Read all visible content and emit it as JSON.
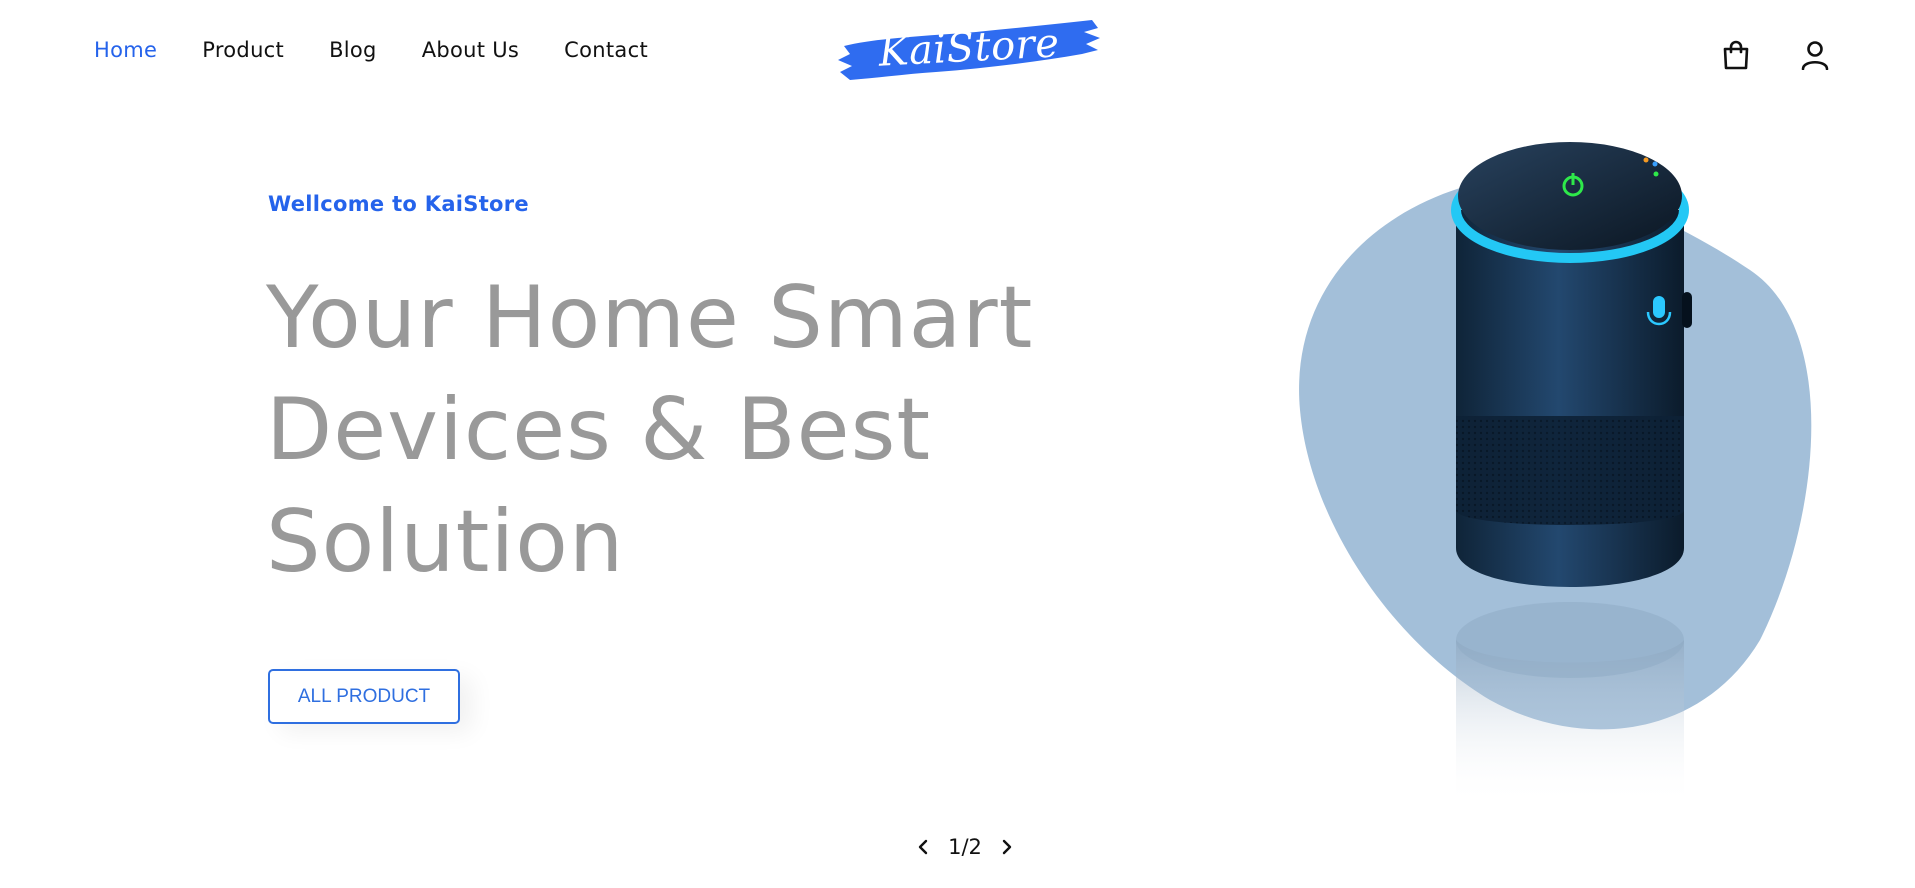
{
  "nav": {
    "items": [
      {
        "label": "Home",
        "active": true
      },
      {
        "label": "Product",
        "active": false
      },
      {
        "label": "Blog",
        "active": false
      },
      {
        "label": "About Us",
        "active": false
      },
      {
        "label": "Contact",
        "active": false
      }
    ]
  },
  "brand": {
    "logo_text": "KaiStore",
    "accent_color": "#2563eb"
  },
  "header_icons": {
    "cart": "shopping-bag-icon",
    "account": "user-icon"
  },
  "hero": {
    "eyebrow": "Wellcome to KaiStore",
    "headline_lines": [
      "Your Home Smart",
      "Devices & Best",
      "Solution"
    ],
    "cta_label": "ALL PRODUCT",
    "image": "smart-speaker"
  },
  "pager": {
    "current": "1/2"
  }
}
